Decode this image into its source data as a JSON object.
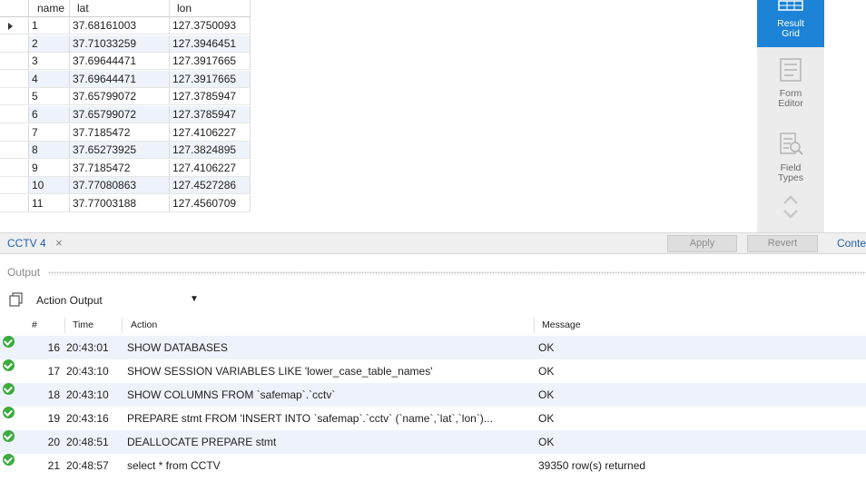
{
  "grid": {
    "columns": [
      "name",
      "lat",
      "lon"
    ],
    "rows": [
      [
        "1",
        "37.68161003",
        "127.3750093"
      ],
      [
        "2",
        "37.71033259",
        "127.3946451"
      ],
      [
        "3",
        "37.69644471",
        "127.3917665"
      ],
      [
        "4",
        "37.69644471",
        "127.3917665"
      ],
      [
        "5",
        "37.65799072",
        "127.3785947"
      ],
      [
        "6",
        "37.65799072",
        "127.3785947"
      ],
      [
        "7",
        "37.7185472",
        "127.4106227"
      ],
      [
        "8",
        "37.65273925",
        "127.3824895"
      ],
      [
        "9",
        "37.7185472",
        "127.4106227"
      ],
      [
        "10",
        "37.77080863",
        "127.4527286"
      ],
      [
        "11",
        "37.77003188",
        "127.4560709"
      ]
    ]
  },
  "side_panel": {
    "result_grid": [
      "Result",
      "Grid"
    ],
    "form_editor": [
      "Form",
      "Editor"
    ],
    "field_types": [
      "Field",
      "Types"
    ],
    "active_color": "#1c83d6"
  },
  "tabs": {
    "active_tab": "CCTV 4",
    "close_glyph": "×",
    "apply_label": "Apply",
    "revert_label": "Revert",
    "more_tab": "Conte"
  },
  "output": {
    "title": "Output",
    "selector": "Action Output",
    "columns": {
      "num": "#",
      "time": "Time",
      "action": "Action",
      "message": "Message"
    },
    "rows": [
      {
        "num": "16",
        "time": "20:43:01",
        "action": "SHOW DATABASES",
        "message": "OK"
      },
      {
        "num": "17",
        "time": "20:43:10",
        "action": "SHOW SESSION VARIABLES LIKE 'lower_case_table_names'",
        "message": "OK"
      },
      {
        "num": "18",
        "time": "20:43:10",
        "action": "SHOW COLUMNS FROM `safemap`.`cctv`",
        "message": "OK"
      },
      {
        "num": "19",
        "time": "20:43:16",
        "action": "PREPARE stmt FROM 'INSERT INTO `safemap`.`cctv` (`name`,`lat`,`lon`)...",
        "message": "OK"
      },
      {
        "num": "20",
        "time": "20:48:51",
        "action": "DEALLOCATE PREPARE stmt",
        "message": "OK"
      },
      {
        "num": "21",
        "time": "20:48:57",
        "action": "select * from CCTV",
        "message": "39350 row(s) returned"
      }
    ],
    "status_color": "#3bab3d"
  }
}
